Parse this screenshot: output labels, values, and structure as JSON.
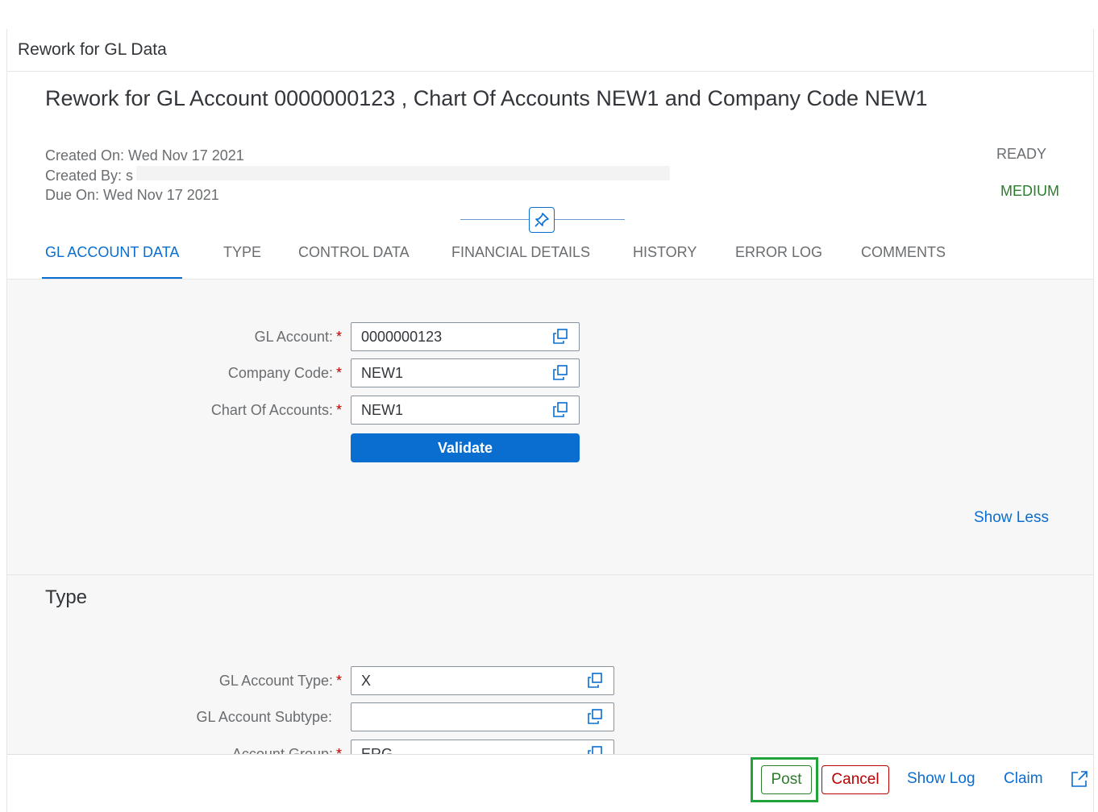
{
  "app": {
    "title": "Rework for GL Data"
  },
  "header": {
    "title": "Rework for GL Account 0000000123 , Chart Of Accounts NEW1 and Company Code NEW1",
    "created_on": "Created On: Wed Nov 17 2021",
    "created_by": "Created By: s",
    "due_on": "Due On: Wed Nov 17 2021",
    "status": "READY",
    "priority": "MEDIUM",
    "priority_color": "#2b7d2b"
  },
  "tabs": [
    {
      "label": "GL ACCOUNT DATA",
      "active": true
    },
    {
      "label": "TYPE"
    },
    {
      "label": "CONTROL DATA"
    },
    {
      "label": "FINANCIAL DETAILS"
    },
    {
      "label": "HISTORY"
    },
    {
      "label": "ERROR LOG"
    },
    {
      "label": "COMMENTS"
    }
  ],
  "gl_section": {
    "fields": [
      {
        "label": "GL Account:",
        "value": "0000000123",
        "required": true
      },
      {
        "label": "Company Code:",
        "value": "NEW1",
        "required": true
      },
      {
        "label": "Chart Of Accounts:",
        "value": "NEW1",
        "required": true
      }
    ],
    "validate_label": "Validate",
    "show_less_label": "Show Less"
  },
  "type_section": {
    "heading": "Type",
    "fields": [
      {
        "label": "GL Account Type:",
        "value": "X",
        "required": true
      },
      {
        "label": "GL Account Subtype:",
        "value": "",
        "required": false
      },
      {
        "label": "Account Group:",
        "value": "ERG",
        "required": true
      }
    ]
  },
  "footer": {
    "post": "Post",
    "cancel": "Cancel",
    "show_log": "Show Log",
    "claim": "Claim"
  },
  "icons": {
    "value_help": "value-help-icon",
    "pin": "pin-icon",
    "share": "share-icon"
  },
  "colors": {
    "accent": "#0a6ed1",
    "post_highlight": "#1fa33a",
    "cancel": "#bb0000"
  }
}
